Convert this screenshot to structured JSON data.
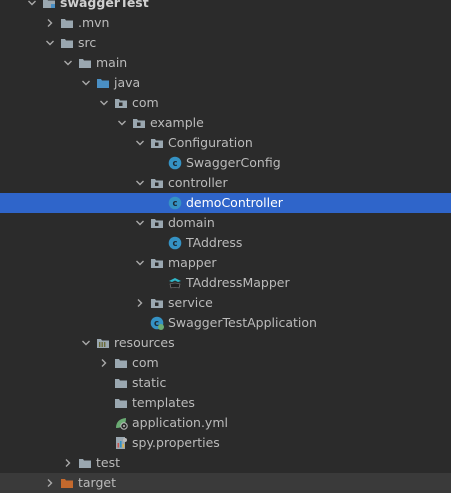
{
  "project_tree": {
    "items": [
      {
        "label": "swaggerTest",
        "icon": "module-folder-icon",
        "expanded": true,
        "depth": 0
      },
      {
        "label": ".mvn",
        "icon": "folder-icon",
        "expanded": false,
        "depth": 1
      },
      {
        "label": "src",
        "icon": "folder-icon",
        "expanded": true,
        "depth": 1
      },
      {
        "label": "main",
        "icon": "folder-icon",
        "expanded": true,
        "depth": 2
      },
      {
        "label": "java",
        "icon": "source-folder-icon",
        "expanded": true,
        "depth": 3
      },
      {
        "label": "com",
        "icon": "package-icon",
        "expanded": true,
        "depth": 4
      },
      {
        "label": "example",
        "icon": "package-icon",
        "expanded": true,
        "depth": 5
      },
      {
        "label": "Configuration",
        "icon": "package-icon",
        "expanded": true,
        "depth": 6
      },
      {
        "label": "SwaggerConfig",
        "icon": "class-icon",
        "depth": 7
      },
      {
        "label": "controller",
        "icon": "package-icon",
        "expanded": true,
        "depth": 6
      },
      {
        "label": "demoController",
        "icon": "class-icon",
        "depth": 7,
        "selected": true
      },
      {
        "label": "domain",
        "icon": "package-icon",
        "expanded": true,
        "depth": 6
      },
      {
        "label": "TAddress",
        "icon": "class-icon",
        "depth": 7
      },
      {
        "label": "mapper",
        "icon": "package-icon",
        "expanded": true,
        "depth": 6
      },
      {
        "label": "TAddressMapper",
        "icon": "mybatis-mapper-icon",
        "depth": 7
      },
      {
        "label": "service",
        "icon": "package-icon",
        "expanded": false,
        "depth": 6
      },
      {
        "label": "SwaggerTestApplication",
        "icon": "spring-boot-class-icon",
        "depth": 6
      },
      {
        "label": "resources",
        "icon": "resources-folder-icon",
        "expanded": true,
        "depth": 3
      },
      {
        "label": "com",
        "icon": "folder-icon",
        "expanded": false,
        "depth": 4
      },
      {
        "label": "static",
        "icon": "folder-icon",
        "depth": 4
      },
      {
        "label": "templates",
        "icon": "folder-icon",
        "depth": 4
      },
      {
        "label": "application.yml",
        "icon": "spring-yml-icon",
        "depth": 4
      },
      {
        "label": "spy.properties",
        "icon": "properties-file-icon",
        "depth": 4
      },
      {
        "label": "test",
        "icon": "folder-icon",
        "expanded": false,
        "depth": 2
      },
      {
        "label": "target",
        "icon": "excluded-folder-icon",
        "expanded": false,
        "depth": 1
      }
    ]
  },
  "colors": {
    "background": "#2b2b2b",
    "text": "#bbbbbb",
    "selection": "#2f65ca",
    "folder": "#9aa7b0",
    "source_folder": "#4a8fc4",
    "class_circle": "#3592c4",
    "excluded_folder": "#c4692d",
    "spring": "#6aab73"
  }
}
